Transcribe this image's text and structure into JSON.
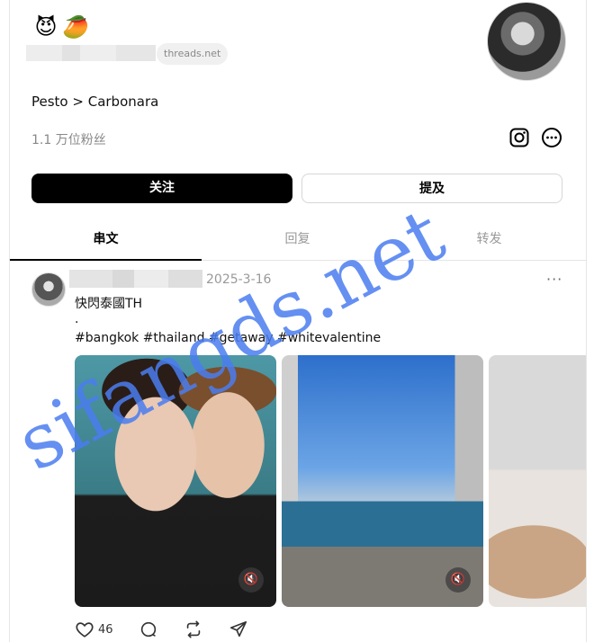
{
  "profile": {
    "emojis": [
      "😈",
      "🥭"
    ],
    "domain_badge": "threads.net",
    "bio": "Pesto > Carbonara",
    "followers": "1.1 万位粉丝"
  },
  "buttons": {
    "follow": "关注",
    "mention": "提及"
  },
  "tabs": [
    {
      "label": "串文",
      "active": true
    },
    {
      "label": "回复",
      "active": false
    },
    {
      "label": "转发",
      "active": false
    }
  ],
  "post": {
    "date": "2025-3-16",
    "more": "···",
    "line1": "快閃泰國TH",
    "line2": ".",
    "line3": "#bangkok #thailand #getaway #whitevalentine",
    "likes": "46",
    "media": [
      {
        "kind": "video",
        "icon": "mute-icon"
      },
      {
        "kind": "video",
        "icon": "mute-icon"
      },
      {
        "kind": "image"
      }
    ]
  },
  "watermark": "sifangds.net",
  "colors": {
    "watermark": "#4a7cf0",
    "primary": "#000000",
    "muted": "#999999"
  }
}
